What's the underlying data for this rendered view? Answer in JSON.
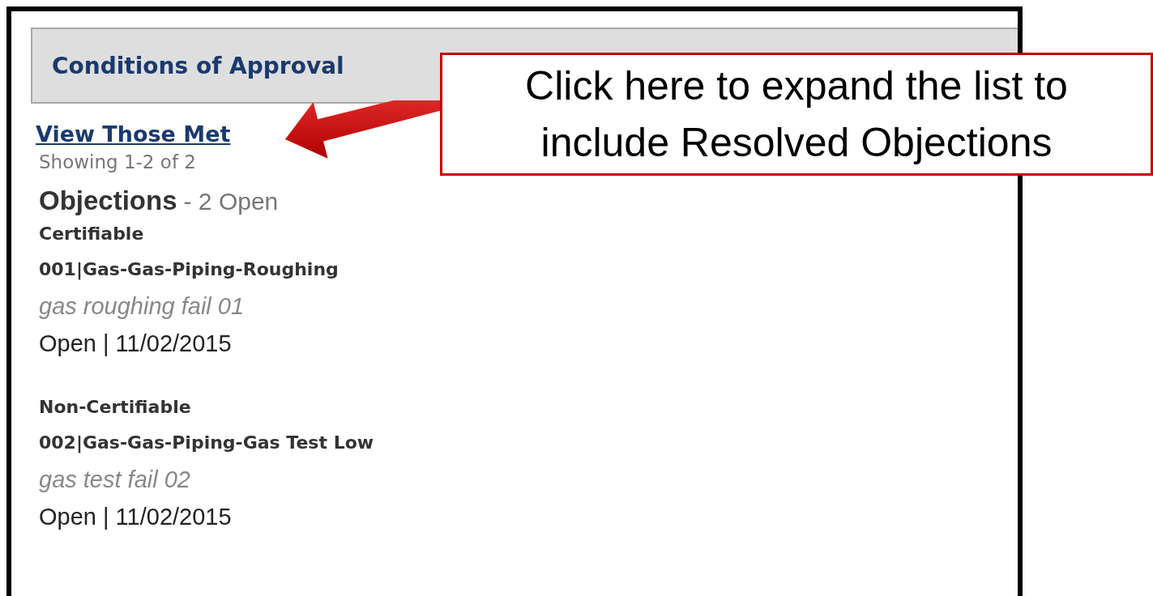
{
  "panel": {
    "title": "Conditions of Approval"
  },
  "view_link": "View Those Met",
  "showing": "Showing 1-2 of 2",
  "section": {
    "title": "Objections",
    "summary": "- 2 Open"
  },
  "objections": [
    {
      "category": "Certifiable",
      "name": "001|Gas-Gas-Piping-Roughing",
      "comment": "gas roughing fail 01",
      "status": "Open | 11/02/2015"
    },
    {
      "category": "Non-Certifiable",
      "name": "002|Gas-Gas-Piping-Gas Test Low",
      "comment": "gas test fail 02",
      "status": "Open | 11/02/2015"
    }
  ],
  "callout": {
    "text": "Click here to expand the list to include Resolved Objections"
  }
}
